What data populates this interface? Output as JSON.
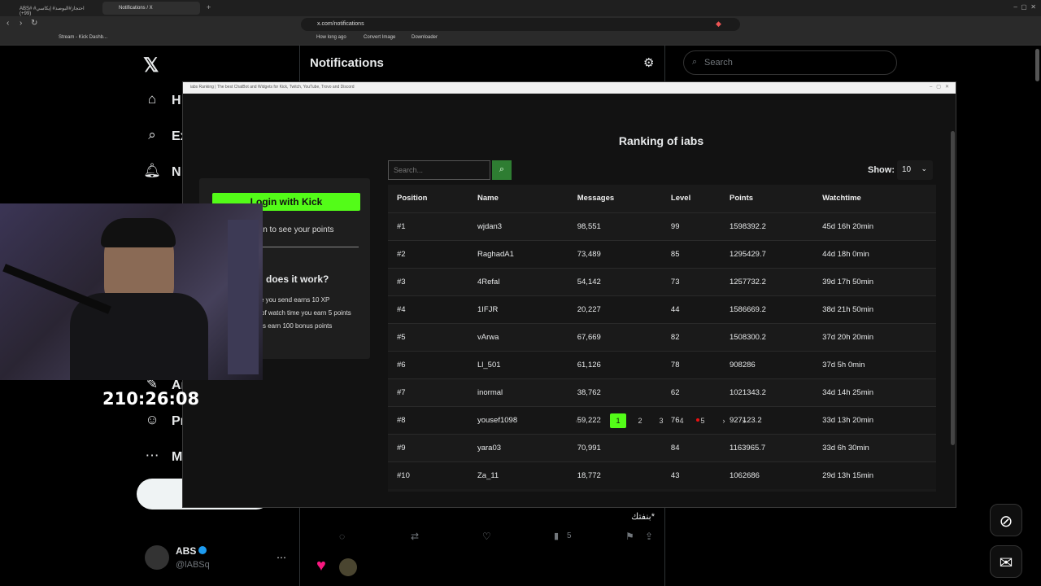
{
  "browser": {
    "tabs": [
      {
        "label": "ABS# #احتجاز#البوصد# إيكاسي (99+)",
        "active": false
      },
      {
        "label": "Notifications / X",
        "active": true
      }
    ],
    "url": "x.com/notifications",
    "bookmarks": [
      "Stream - Kick Dashb...",
      "How long ago",
      "Convert Image",
      "Downloader"
    ]
  },
  "x": {
    "page_title": "Notifications",
    "search_placeholder": "Search",
    "nav": [
      "H",
      "Ex",
      "N",
      "Ar",
      "Pr",
      "M"
    ],
    "account_name": "ABS",
    "account_handle": "@lABSq",
    "tweet_text": "بنفتك*",
    "tweet_views": "5"
  },
  "overlay": {
    "window_title": "iabs Ranking | The best ChatBot and Widgets for Kick, Twitch, YouTube, Trovo and Discord",
    "heading": "Ranking of iabs",
    "login_button": "Login with Kick",
    "login_hint": "in to see your points",
    "how_heading": "does it work?",
    "how_lines": [
      "age you send earns 10 XP",
      "of watch time you earn 5 points",
      "s earn 100 bonus points"
    ],
    "search_placeholder": "Search...",
    "show_label": "Show:",
    "show_value": "10",
    "columns": [
      "Position",
      "Name",
      "Messages",
      "Level",
      "Points",
      "Watchtime"
    ],
    "rows": [
      [
        "#1",
        "wjdan3",
        "98,551",
        "99",
        "1598392.2",
        "45d 16h 20min"
      ],
      [
        "#2",
        "RaghadA1",
        "73,489",
        "85",
        "1295429.7",
        "44d 18h 0min"
      ],
      [
        "#3",
        "4Refal",
        "54,142",
        "73",
        "1257732.2",
        "39d 17h 50min"
      ],
      [
        "#4",
        "1IFJR",
        "20,227",
        "44",
        "1586669.2",
        "38d 21h 50min"
      ],
      [
        "#5",
        "vArwa",
        "67,669",
        "82",
        "1508300.2",
        "37d 20h 20min"
      ],
      [
        "#6",
        "Ll_501",
        "61,126",
        "78",
        "908286",
        "37d 5h 0min"
      ],
      [
        "#7",
        "inormal",
        "38,762",
        "62",
        "1021343.2",
        "34d 14h 25min"
      ],
      [
        "#8",
        "yousef1098",
        "59,222",
        "76",
        "927123.2",
        "33d 13h 20min"
      ],
      [
        "#9",
        "yara03",
        "70,991",
        "84",
        "1163965.7",
        "33d 6h 30min"
      ],
      [
        "#10",
        "Za_11",
        "18,772",
        "43",
        "1062686",
        "29d 13h 15min"
      ]
    ],
    "pages": [
      "1",
      "2",
      "3",
      "4",
      "5"
    ],
    "active_page": "1"
  },
  "stream": {
    "timer": "210:26:08"
  },
  "colors": {
    "accent": "#53fc18",
    "x_blue": "#1d9bf0",
    "bg": "#000000"
  }
}
